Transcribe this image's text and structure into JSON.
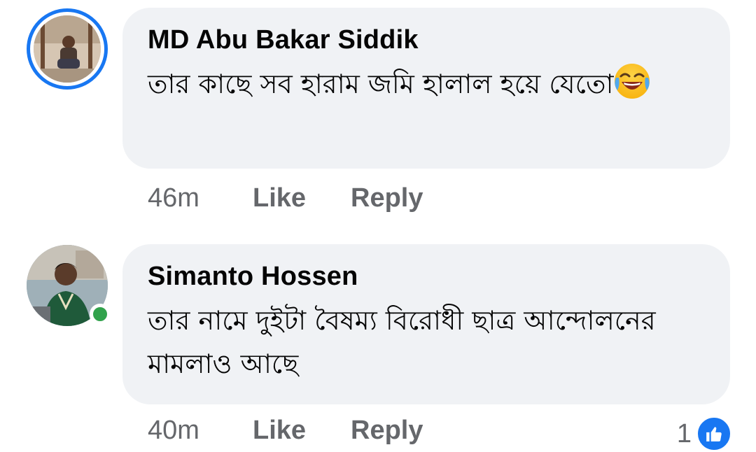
{
  "comments": [
    {
      "author": "MD Abu Bakar Siddik",
      "text": "তার কাছে সব হারাম জমি হালাল হয়ে যেতো",
      "emoji": "face-with-tears-of-joy",
      "time": "46m",
      "like_label": "Like",
      "reply_label": "Reply",
      "has_story_ring": true
    },
    {
      "author": "Simanto Hossen",
      "text": "তার নামে দুইটা বৈষম্য বিরোধী ছাত্র আন্দোলনের মামলাও আছে",
      "time": "40m",
      "like_label": "Like",
      "reply_label": "Reply",
      "online": true,
      "reaction_count": "1",
      "reaction_icon": "like-reaction-icon"
    }
  ],
  "colors": {
    "bubble": "#f0f2f5",
    "text": "#050505",
    "meta": "#65676b",
    "accent": "#1877f2",
    "online": "#31a24c"
  }
}
